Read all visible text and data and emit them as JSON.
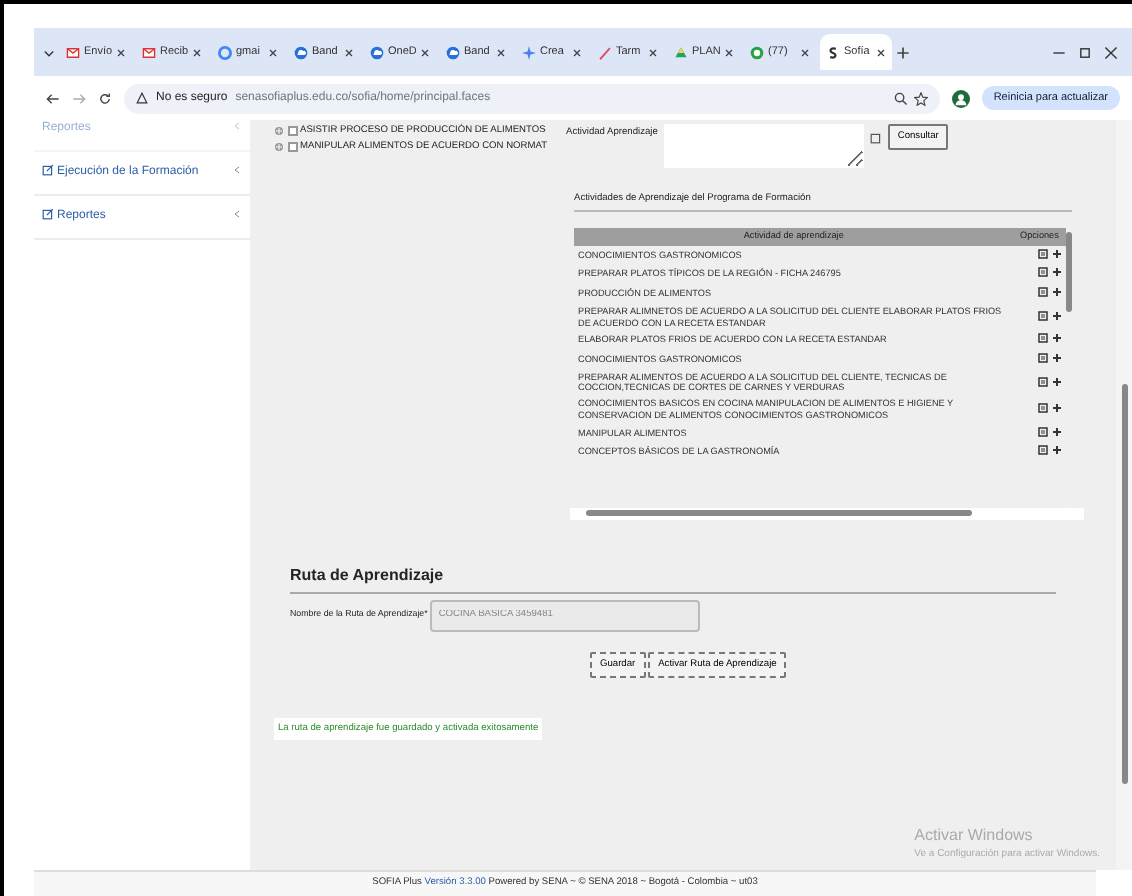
{
  "browser": {
    "tabs": [
      {
        "label": "Envío",
        "kind": "mail",
        "selected": false
      },
      {
        "label": "Recib",
        "kind": "mail",
        "selected": false
      },
      {
        "label": "gmai",
        "kind": "search",
        "selected": false
      },
      {
        "label": "Band",
        "kind": "cloud",
        "selected": false
      },
      {
        "label": "OneD",
        "kind": "cloud",
        "selected": false
      },
      {
        "label": "Band",
        "kind": "cloud",
        "selected": false
      },
      {
        "label": "Crea",
        "kind": "star",
        "selected": false
      },
      {
        "label": "Tarm",
        "kind": "pen",
        "selected": false
      },
      {
        "label": "PLAN",
        "kind": "drive",
        "selected": false
      },
      {
        "label": "(77)",
        "kind": "chat",
        "selected": false
      },
      {
        "label": "Sofía",
        "kind": "site",
        "selected": true
      }
    ],
    "security": "No es seguro",
    "url": "senasofiaplus.edu.co/sofia/home/principal.faces",
    "update_button": "Reinicia para actualizar"
  },
  "sidebar": {
    "items": [
      {
        "label": "Reportes"
      },
      {
        "label": "Ejecución de la Formación"
      },
      {
        "label": "Reportes"
      }
    ]
  },
  "tree": [
    {
      "label": "ASISTIR PROCESO DE PRODUCCIÓN DE ALIMENTOS",
      "checked": false
    },
    {
      "label": "MANIPULAR ALIMENTOS DE ACUERDO CON NORMAT",
      "checked": false
    }
  ],
  "search": {
    "label": "Actividad Aprendizaje",
    "button": "Consultar"
  },
  "activities": {
    "title": "Actividades de Aprendizaje del Programa de Formación",
    "columns": [
      "Actividad de aprendizaje",
      "Opciones"
    ],
    "rows": [
      "CONOCIMIENTOS GASTRONOMICOS",
      "PREPARAR PLATOS TÍPICOS DE LA REGIÓN - FICHA 246795",
      "PRODUCCIÓN DE ALIMENTOS",
      "PREPARAR ALIMNETOS DE ACUERDO A LA SOLICITUD DEL CLIENTE ELABORAR PLATOS FRIOS DE ACUERDO CON LA RECETA ESTANDAR",
      "ELABORAR PLATOS FRIOS DE ACUERDO CON LA RECETA ESTANDAR",
      "CONOCIMIENTOS GASTRONOMICOS",
      "PREPARAR ALIMENTOS DE ACUERDO A LA SOLICITUD DEL CLIENTE, TECNICAS DE COCCION,TECNICAS DE CORTES DE CARNES Y VERDURAS",
      "CONOCIMIENTOS BASICOS EN COCINA MANIPULACION DE ALIMENTOS E HIGIENE Y CONSERVACION DE ALIMENTOS CONOCIMIENTOS GASTRONOMICOS",
      "MANIPULAR ALIMENTOS",
      "CONCEPTOS BÁSICOS DE LA GASTRONOMÍA"
    ]
  },
  "route": {
    "title": "Ruta de Aprendizaje",
    "field_label": "Nombre de la Ruta de Aprendizaje*",
    "field_value": "COCINA BASICA 3459481",
    "buttons": [
      "Guardar",
      "Activar Ruta de Aprendizaje"
    ],
    "message": "La ruta de aprendizaje fue guardado y activada exitosamente"
  },
  "windows_notice": {
    "title": "Activar Windows",
    "text": "Ve a Configuración para activar Windows."
  },
  "footer": {
    "before": "SOFIA Plus",
    "version": "Versión 3.3.00",
    "after": "Powered by SENA ~ © SENA 2018 ~ Bogotá - Colombia ~ ut03"
  }
}
